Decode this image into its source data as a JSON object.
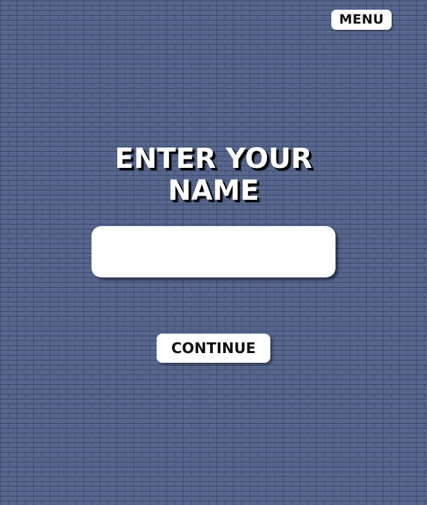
{
  "header": {
    "menu_label": "MENU"
  },
  "main": {
    "title_line1": "ENTER YOUR",
    "title_line2": "NAME",
    "name_input": {
      "value": "",
      "placeholder": ""
    },
    "continue_label": "CONTINUE"
  },
  "colors": {
    "background": "#55658c",
    "button_background": "#ffffff",
    "text_dark": "#111111",
    "title_text": "#ffffff",
    "title_shadow": "#000000"
  }
}
